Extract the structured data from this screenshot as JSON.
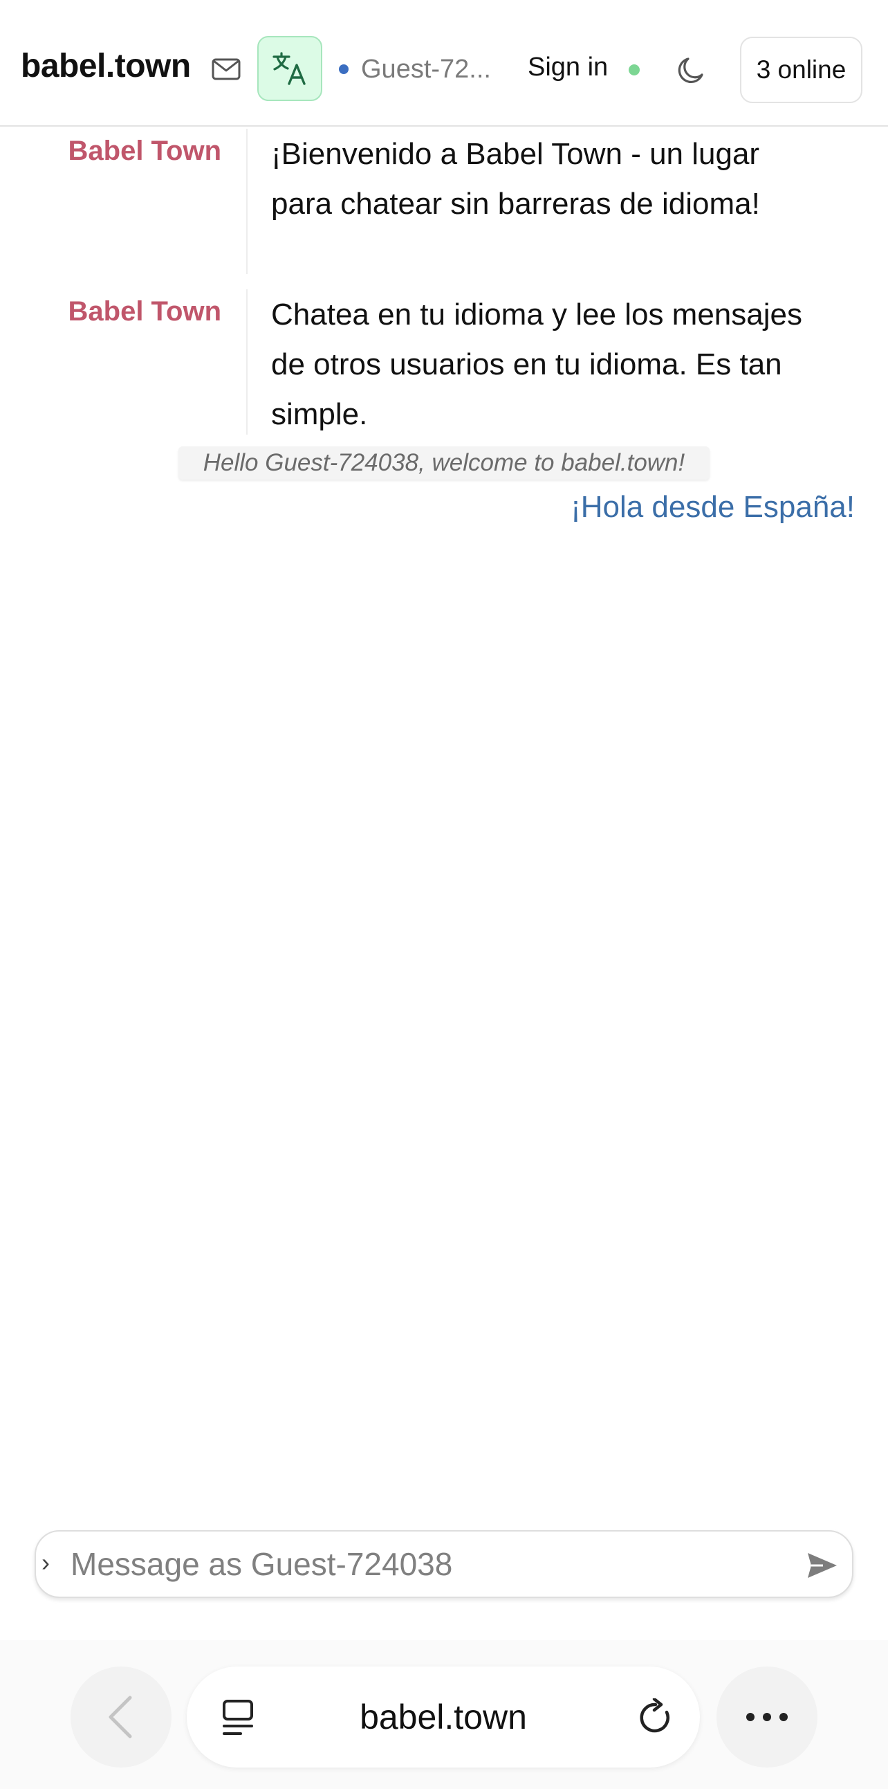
{
  "header": {
    "brand": "babel.town",
    "user_name": "Guest-72...",
    "sign_in_label": "Sign in",
    "online_label": "3 online"
  },
  "messages": [
    {
      "author": "Babel Town",
      "text": "¡Bienvenido a Babel Town - un lugar para chatear sin barreras de idioma!"
    },
    {
      "author": "Babel Town",
      "text": "Chatea en tu idioma y lee los mensajes de otros usuarios en tu idioma. Es tan simple."
    }
  ],
  "notice": "Hello Guest-724038, welcome to babel.town!",
  "own_message": "¡Hola desde España!",
  "composer": {
    "placeholder": "Message as Guest-724038",
    "value": ""
  },
  "browser": {
    "url": "babel.town"
  },
  "colors": {
    "accent_green_bg": "#dcfbe6",
    "author_color": "#c0566b",
    "own_message_color": "#3b6ea8",
    "status_online": "#7cd693",
    "status_user": "#3b6ec1"
  }
}
